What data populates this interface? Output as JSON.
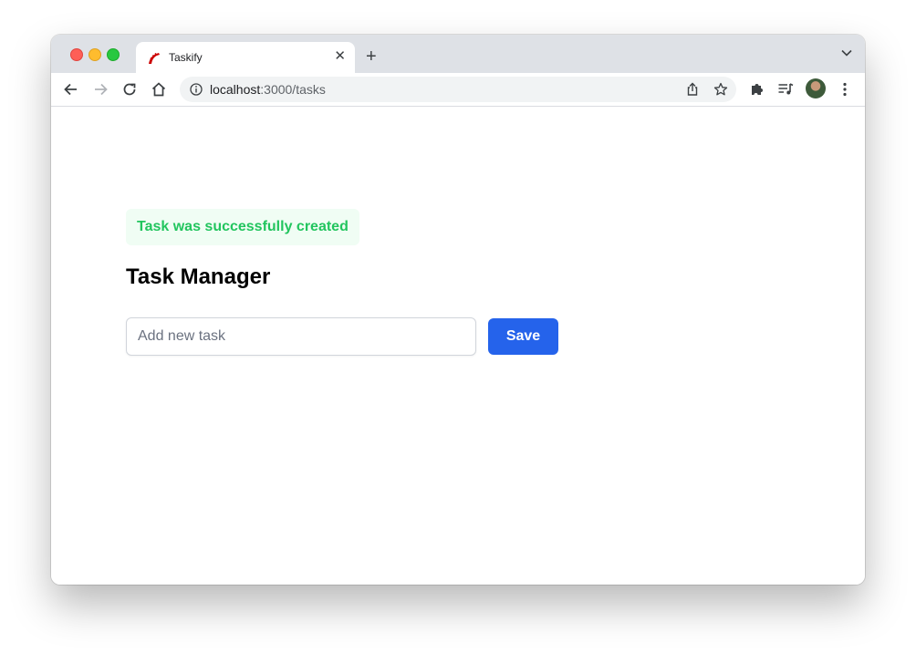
{
  "browser": {
    "tab_title": "Taskify",
    "url_host": "localhost",
    "url_rest": ":3000/tasks",
    "icons": {
      "favicon": "rails-icon",
      "back": "arrow-left-icon",
      "forward": "arrow-right-icon",
      "reload": "reload-icon",
      "home": "home-icon",
      "info": "info-icon",
      "share": "share-icon",
      "bookmark": "star-icon",
      "extensions": "puzzle-icon",
      "media": "media-control-icon",
      "menu": "more-vertical-icon"
    }
  },
  "page": {
    "flash_message": "Task was successfully created",
    "title": "Task Manager",
    "input_placeholder": "Add new task",
    "save_label": "Save"
  },
  "colors": {
    "flash_text": "#22c55e",
    "flash_bg": "#f0fdf4",
    "primary_button": "#2563eb"
  }
}
